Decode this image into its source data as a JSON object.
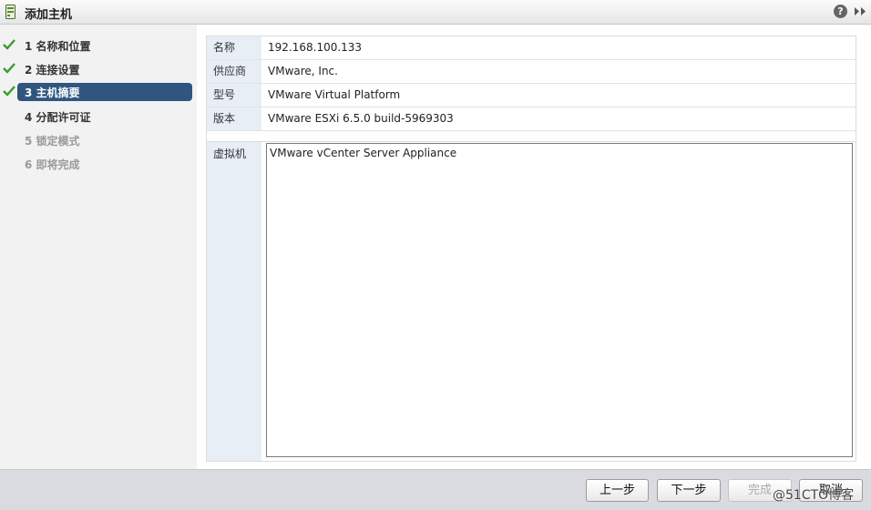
{
  "window": {
    "title": "添加主机",
    "help_glyph": "?"
  },
  "steps": [
    {
      "label": "1  名称和位置",
      "state": "done"
    },
    {
      "label": "2  连接设置",
      "state": "done"
    },
    {
      "label": "3  主机摘要",
      "state": "active"
    },
    {
      "label": "4  分配许可证",
      "state": "pending"
    },
    {
      "label": "5  锁定模式",
      "state": "disabled"
    },
    {
      "label": "6  即将完成",
      "state": "disabled"
    }
  ],
  "summary": {
    "rows": [
      {
        "key": "名称",
        "value": "192.168.100.133"
      },
      {
        "key": "供应商",
        "value": "VMware, Inc."
      },
      {
        "key": "型号",
        "value": "VMware Virtual Platform"
      },
      {
        "key": "版本",
        "value": "VMware ESXi 6.5.0 build-5969303"
      }
    ],
    "vm_label": "虚拟机",
    "vms": [
      "VMware vCenter Server Appliance"
    ]
  },
  "footer": {
    "back_label": "上一步",
    "next_label": "下一步",
    "finish_label": "完成",
    "cancel_label": "取消"
  },
  "watermark": "@51CTO博客",
  "colors": {
    "active_step_bg": "#30567f",
    "check_green": "#3a9c2e",
    "key_cell_bg": "#e8eef6",
    "footer_bg": "#d9dbe0"
  }
}
